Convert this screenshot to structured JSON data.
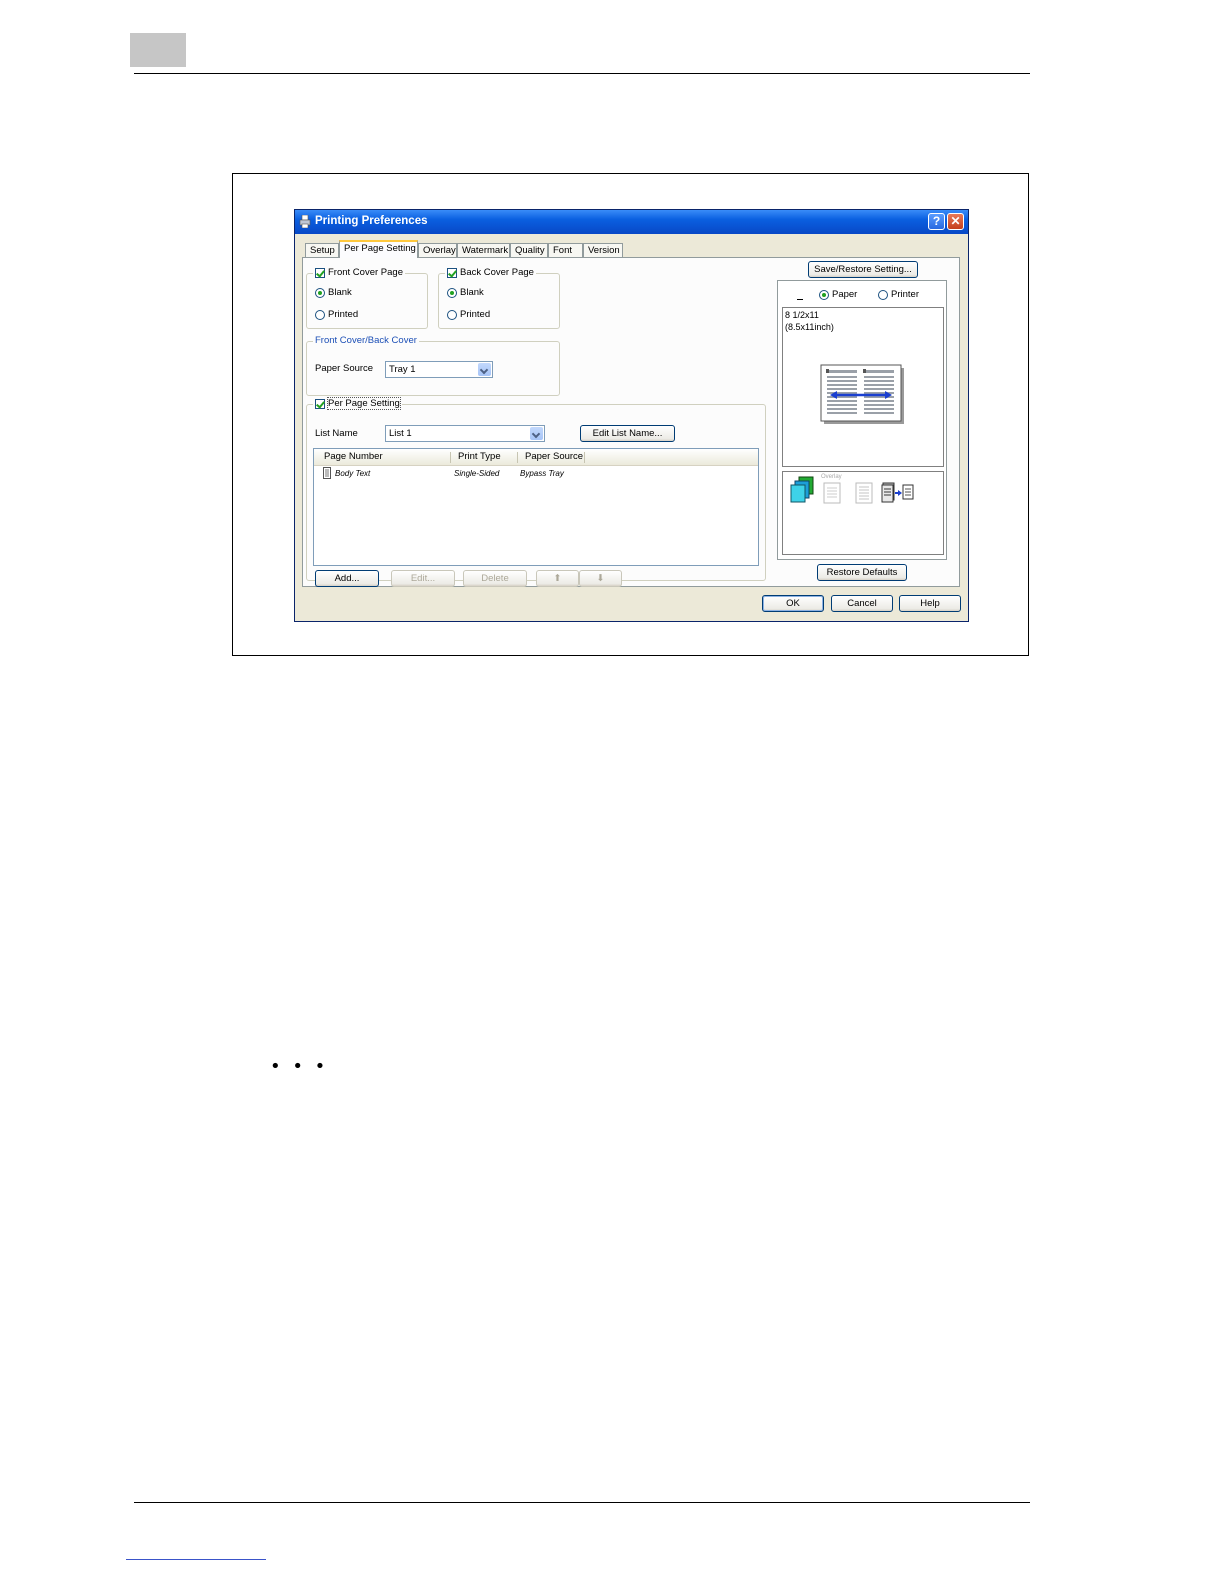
{
  "dialog": {
    "title": "Printing Preferences",
    "help_glyph": "?",
    "close_glyph": "✕",
    "tabs": [
      {
        "label": "Setup",
        "active": false
      },
      {
        "label": "Per Page Setting",
        "active": true
      },
      {
        "label": "Overlay",
        "active": false
      },
      {
        "label": "Watermark",
        "active": false
      },
      {
        "label": "Quality",
        "active": false
      },
      {
        "label": "Font",
        "active": false
      },
      {
        "label": "Version",
        "active": false
      }
    ],
    "front_cover": {
      "label": "Front Cover Page",
      "checked": true,
      "option_blank": "Blank",
      "option_printed": "Printed",
      "selected": "Blank"
    },
    "back_cover": {
      "label": "Back Cover Page",
      "checked": true,
      "option_blank": "Blank",
      "option_printed": "Printed",
      "selected": "Blank"
    },
    "cover_group": {
      "label": "Front Cover/Back Cover",
      "paper_source_label": "Paper Source",
      "paper_source_value": "Tray 1"
    },
    "per_page": {
      "label": "Per Page Setting",
      "checked": true,
      "list_name_label": "List Name",
      "list_name_value": "List 1",
      "edit_list_name_button": "Edit List Name...",
      "columns": [
        "Page Number",
        "Print Type",
        "Paper Source"
      ],
      "rows": [
        {
          "page_number": "Body Text",
          "print_type": "Single-Sided",
          "paper_source": "Bypass Tray"
        }
      ],
      "add_button": "Add...",
      "edit_button": "Edit...",
      "delete_button": "Delete",
      "up_glyph": "⬆",
      "down_glyph": "⬇"
    },
    "right_panel": {
      "save_restore_button": "Save/Restore Setting...",
      "view_paper": "Paper",
      "view_printer": "Printer",
      "view_selected": "Paper",
      "paper_size_line1": "8 1/2x11",
      "paper_size_line2": "(8.5x11inch)",
      "overlay_mini_label": "Overlay",
      "restore_defaults_button": "Restore Defaults"
    },
    "ok_button": "OK",
    "cancel_button": "Cancel",
    "help_button": "Help"
  },
  "page": {
    "ellipsis": "• • •"
  }
}
